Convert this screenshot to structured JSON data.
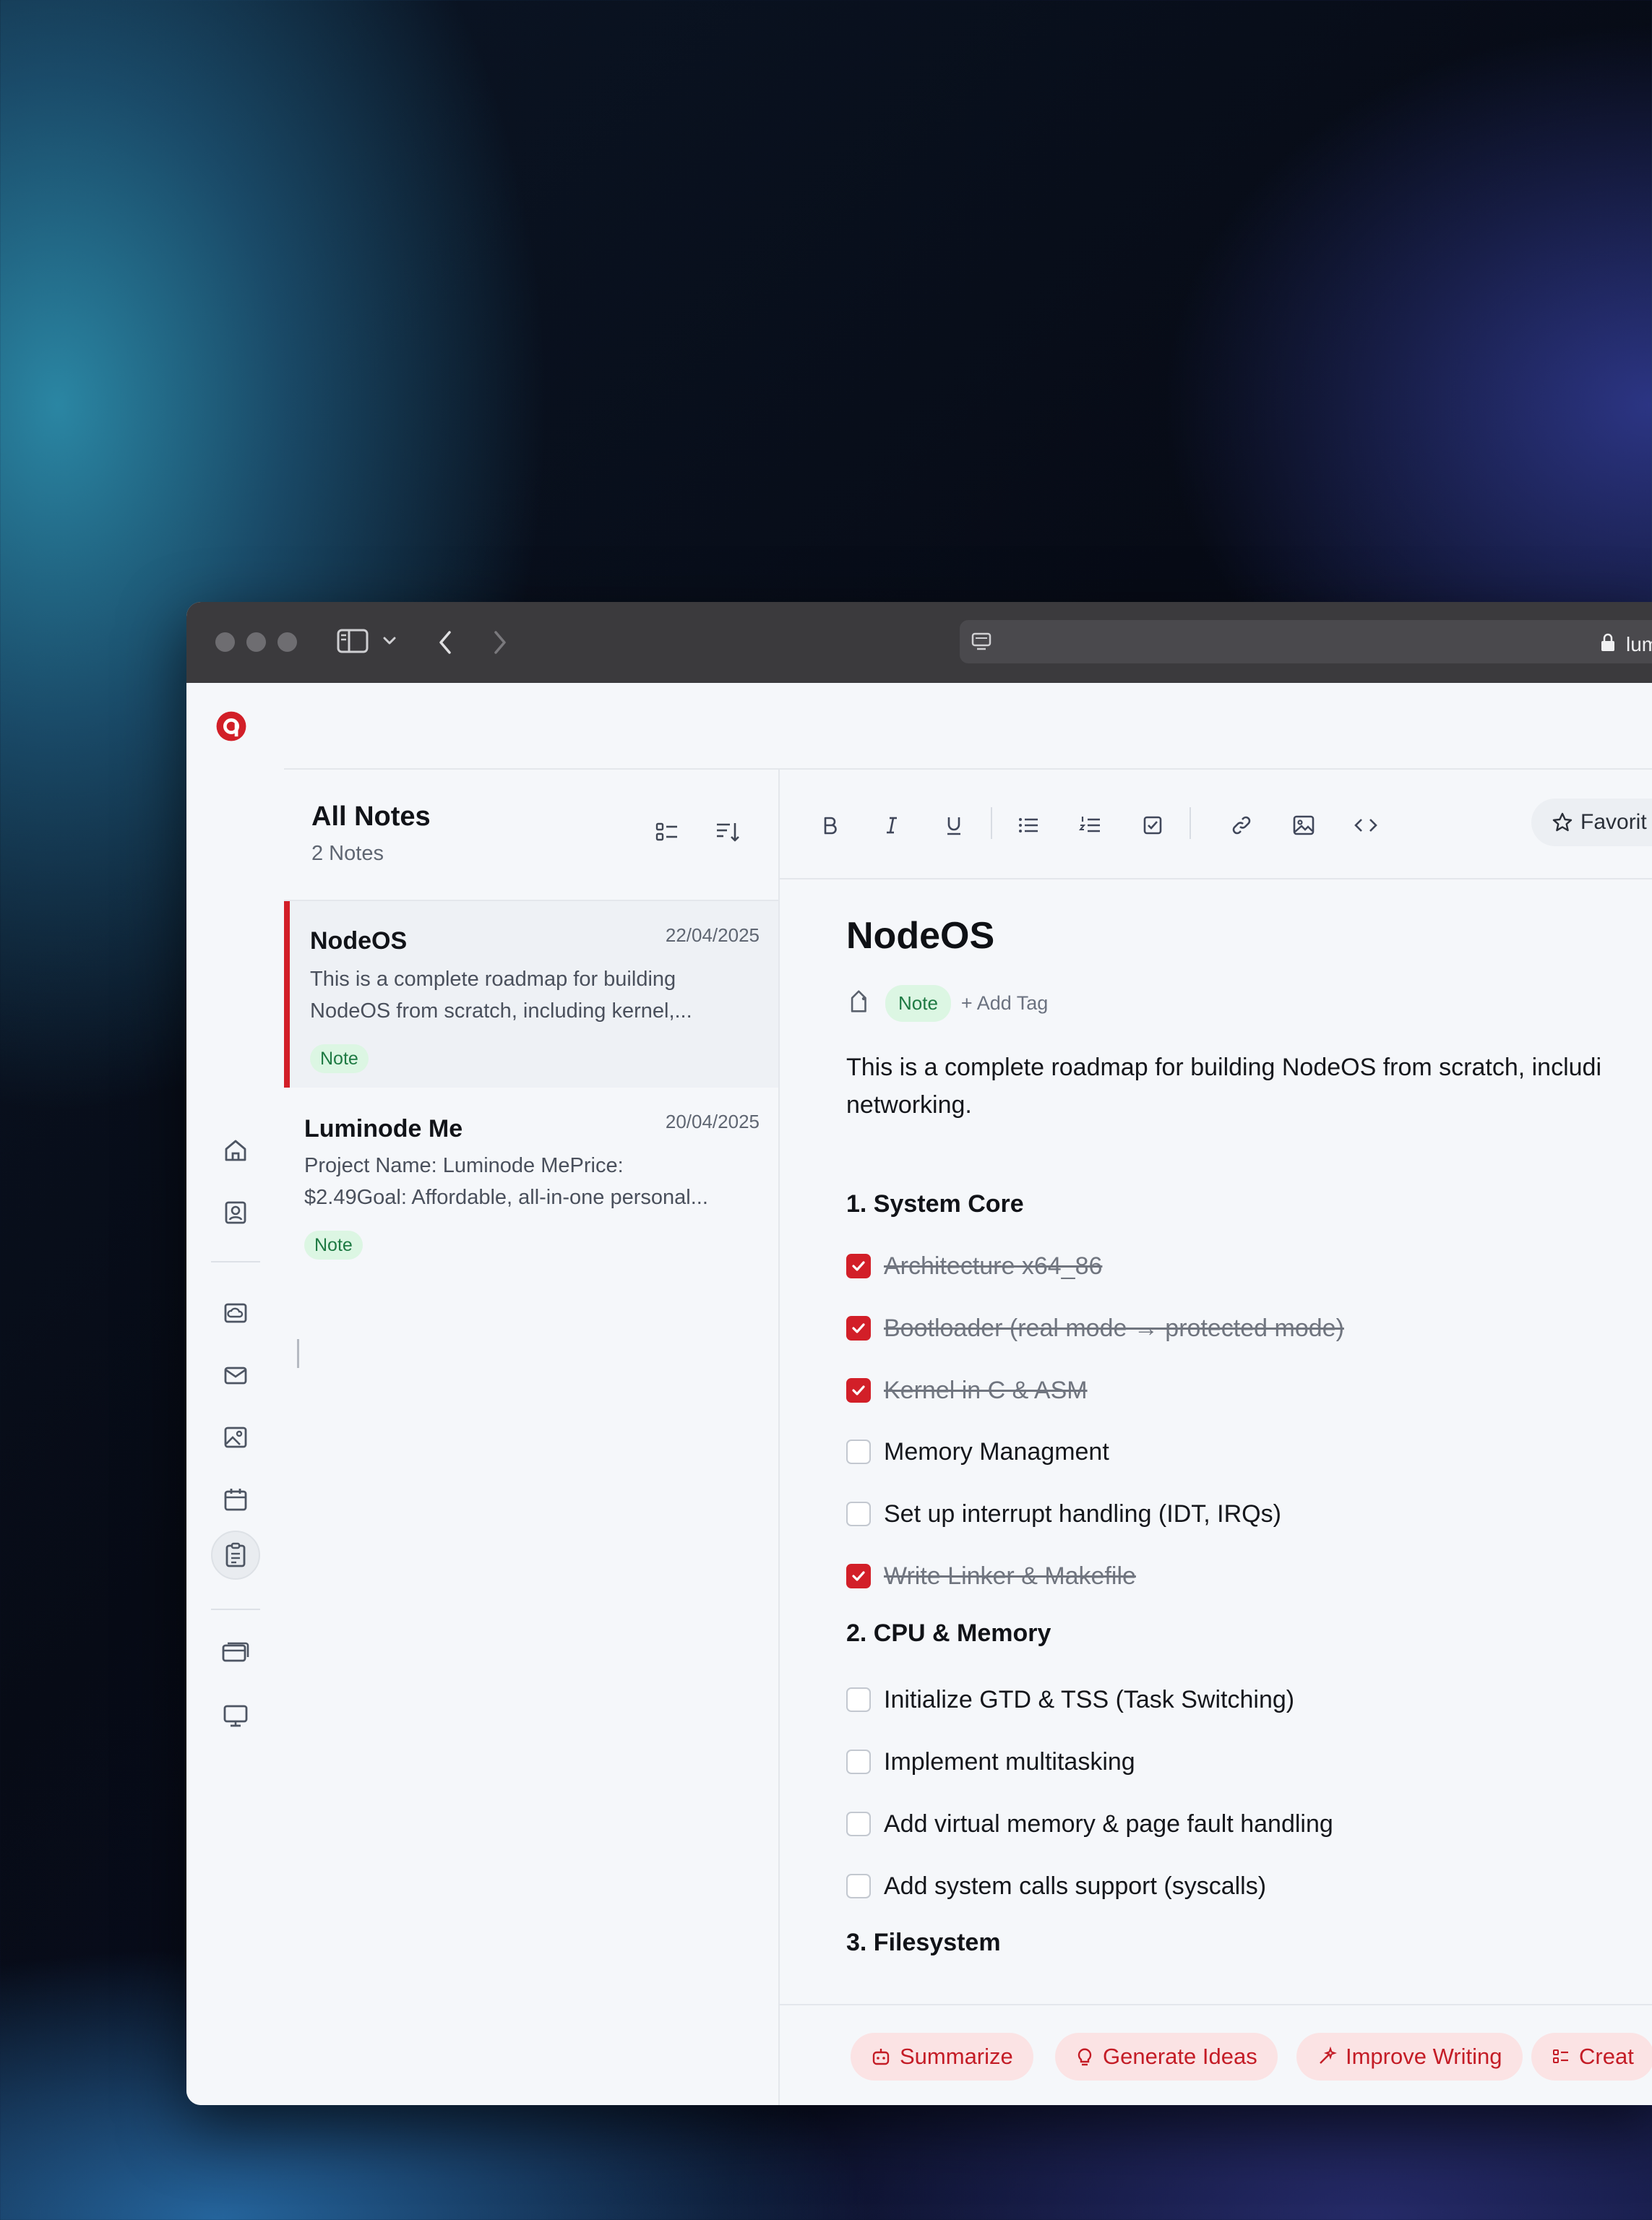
{
  "browser": {
    "url": "luminode.me"
  },
  "note_list": {
    "title": "All Notes",
    "count": "2 Notes",
    "items": [
      {
        "title": "NodeOS",
        "date": "22/04/2025",
        "snippet_line1": "This is a complete roadmap for building",
        "snippet_line2": "NodeOS from scratch, including kernel,...",
        "tag": "Note"
      },
      {
        "title": "Luminode Me",
        "date": "20/04/2025",
        "snippet_line1": "Project Name: Luminode MePrice:",
        "snippet_line2": "$2.49Goal: Affordable, all-in-one personal...",
        "tag": "Note"
      }
    ]
  },
  "toolbar": {
    "favorite_label": "Favorit"
  },
  "document": {
    "title": "NodeOS",
    "tag": "Note",
    "add_tag": "+ Add Tag",
    "intro_line1": "This is a complete roadmap for building NodeOS from scratch, includi",
    "intro_line2": "networking.",
    "sections": [
      {
        "heading": "1. System Core",
        "tasks": [
          {
            "label": "Architecture x64_86",
            "done": true
          },
          {
            "label": "Bootloader (real mode → protected mode)",
            "done": true
          },
          {
            "label": "Kernel in C & ASM",
            "done": true
          },
          {
            "label": "Memory Managment",
            "done": false
          },
          {
            "label": "Set up interrupt handling (IDT, IRQs)",
            "done": false
          },
          {
            "label": "Write Linker & Makefile",
            "done": true
          }
        ]
      },
      {
        "heading": "2. CPU & Memory",
        "tasks": [
          {
            "label": "Initialize GTD & TSS (Task Switching)",
            "done": false
          },
          {
            "label": "Implement multitasking",
            "done": false
          },
          {
            "label": "Add virtual memory & page fault handling",
            "done": false
          },
          {
            "label": "Add system calls support (syscalls)",
            "done": false
          }
        ]
      },
      {
        "heading": "3. Filesystem",
        "tasks": []
      }
    ]
  },
  "ai_actions": {
    "summarize": "Summarize",
    "generate_ideas": "Generate Ideas",
    "improve_writing": "Improve Writing",
    "create": "Creat"
  },
  "colors": {
    "accent": "#d21f28",
    "tag_bg": "#dcf6e3",
    "tag_text": "#1e7a43"
  }
}
